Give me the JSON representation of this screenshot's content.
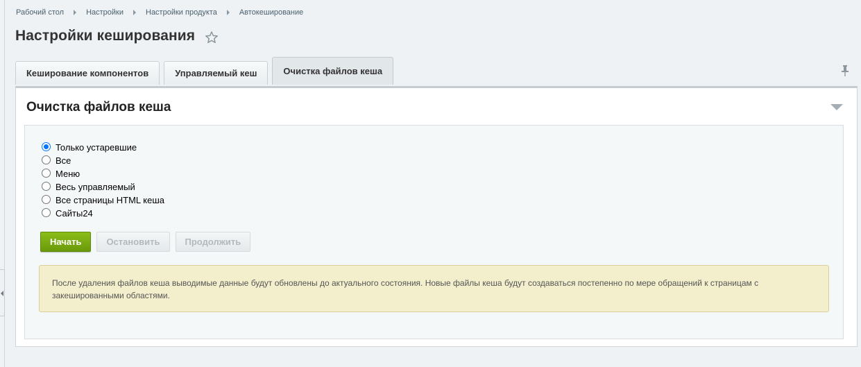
{
  "breadcrumb": [
    "Рабочий стол",
    "Настройки",
    "Настройки продукта",
    "Автокеширование"
  ],
  "page_title": "Настройки кеширования",
  "tabs": [
    {
      "label": "Кеширование компонентов",
      "active": false
    },
    {
      "label": "Управляемый кеш",
      "active": false
    },
    {
      "label": "Очистка файлов кеша",
      "active": true
    }
  ],
  "panel": {
    "title": "Очистка файлов кеша",
    "options": [
      {
        "label": "Только устаревшие",
        "checked": true
      },
      {
        "label": "Все",
        "checked": false
      },
      {
        "label": "Меню",
        "checked": false
      },
      {
        "label": "Весь управляемый",
        "checked": false
      },
      {
        "label": "Все страницы HTML кеша",
        "checked": false
      },
      {
        "label": "Сайты24",
        "checked": false
      }
    ],
    "buttons": {
      "start": "Начать",
      "stop": "Остановить",
      "continue": "Продолжить"
    },
    "notice": "После удаления файлов кеша выводимые данные будут обновлены до актуального состояния. Новые файлы кеша будут создаваться постепенно по мере обращений к страницам с закешированными областями."
  },
  "icons": {
    "star": "star-icon",
    "pin": "pin-icon",
    "collapse": "chevron-down-icon"
  },
  "colors": {
    "primary_button": "#7aac10",
    "notice_bg": "#f3eecb",
    "radio_accent": "#0075ff"
  }
}
